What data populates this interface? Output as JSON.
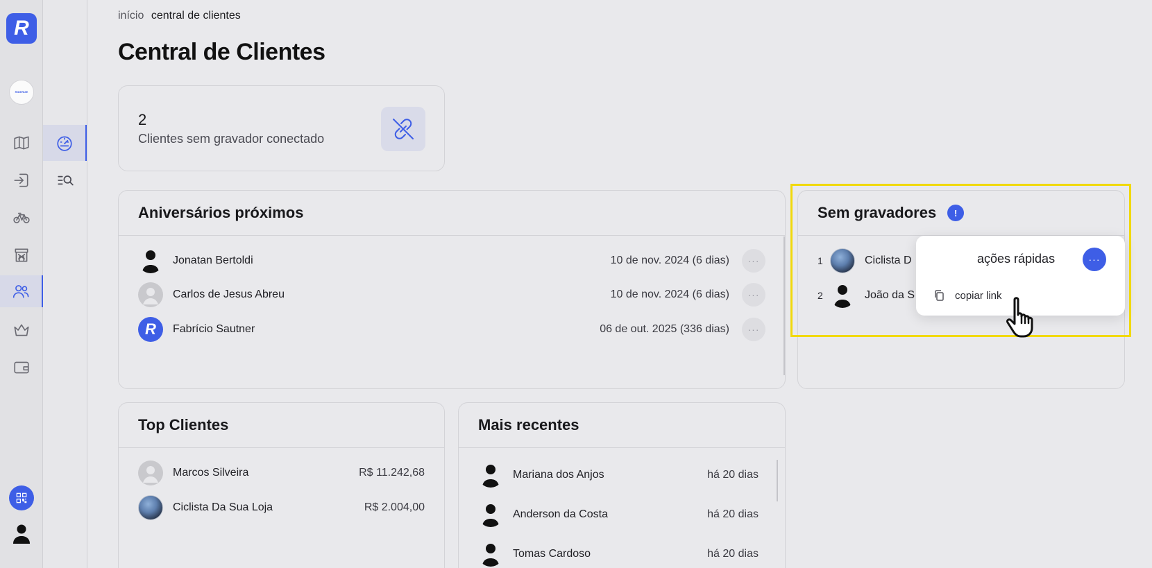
{
  "app": {
    "logo_letter": "R",
    "brand_badge": "RIDERIZE",
    "accent": "#3e5ee6",
    "highlight": "#f1d90a"
  },
  "nav": {
    "rail": [
      {
        "icon": "map-icon"
      },
      {
        "icon": "login-icon"
      },
      {
        "icon": "bicycle-icon"
      },
      {
        "icon": "store-icon"
      },
      {
        "icon": "users-icon",
        "active": true
      },
      {
        "icon": "crown-icon"
      },
      {
        "icon": "wallet-icon"
      }
    ],
    "sub": [
      {
        "icon": "dashboard-gauge-icon",
        "active": true
      },
      {
        "icon": "list-search-icon"
      }
    ]
  },
  "breadcrumb": {
    "home": "início",
    "current": "central de clientes"
  },
  "page_title": "Central de Clientes",
  "stat": {
    "value": "2",
    "label": "Clientes sem gravador conectado",
    "icon": "unlink-icon"
  },
  "birthdays": {
    "title": "Aniversários próximos",
    "rows": [
      {
        "name": "Jonatan Bertoldi",
        "date": "10 de nov. 2024 (6 dias)"
      },
      {
        "name": "Carlos de Jesus Abreu",
        "date": "10 de nov. 2024 (6 dias)"
      },
      {
        "name": "Fabrício Sautner",
        "date": "06 de out. 2025 (336 dias)"
      }
    ]
  },
  "no_recorders": {
    "title": "Sem gravadores",
    "badge": "!",
    "rows": [
      {
        "index": "1",
        "name": "Ciclista D"
      },
      {
        "index": "2",
        "name": "João da S"
      }
    ]
  },
  "quick_actions": {
    "title": "ações rápidas",
    "button": "···",
    "item": "copiar link"
  },
  "top_clients": {
    "title": "Top Clientes",
    "rows": [
      {
        "name": "Marcos Silveira",
        "value": "R$ 11.242,68"
      },
      {
        "name": "Ciclista Da Sua Loja",
        "value": "R$ 2.004,00"
      }
    ]
  },
  "recent": {
    "title": "Mais recentes",
    "rows": [
      {
        "name": "Mariana dos Anjos",
        "when": "há 20 dias"
      },
      {
        "name": "Anderson da Costa",
        "when": "há 20 dias"
      },
      {
        "name": "Tomas Cardoso",
        "when": "há 20 dias"
      }
    ]
  }
}
